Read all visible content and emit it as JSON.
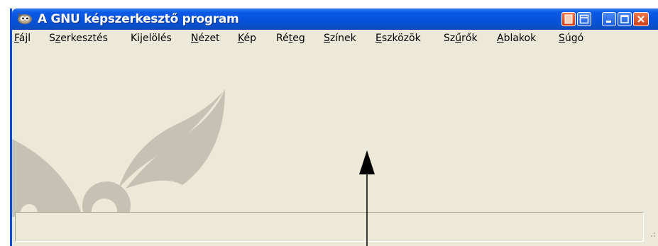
{
  "window": {
    "title": "A GNU képszerkesztő program"
  },
  "menu": [
    {
      "before": "",
      "key": "F",
      "after": "ájl"
    },
    {
      "before": "S",
      "key": "z",
      "after": "erkesztés"
    },
    {
      "before": "Ki",
      "key": "j",
      "after": "elölés"
    },
    {
      "before": "",
      "key": "N",
      "after": "ézet"
    },
    {
      "before": "",
      "key": "K",
      "after": "ép"
    },
    {
      "before": "Ré",
      "key": "t",
      "after": "eg"
    },
    {
      "before": "",
      "key": "S",
      "after": "zínek"
    },
    {
      "before": "",
      "key": "E",
      "after": "szközök"
    },
    {
      "before": "Sz",
      "key": "ű",
      "after": "rők"
    },
    {
      "before": "",
      "key": "A",
      "after": "blakok"
    },
    {
      "before": "",
      "key": "S",
      "after": "úgó"
    }
  ],
  "icons": {
    "app": "gimp-wilber-icon",
    "extra1": "orange-extra-button-icon",
    "extra2": "restore-extra-button-icon",
    "minimize": "minimize-icon",
    "maximize": "maximize-icon",
    "close": "close-icon",
    "pointer": "pointer-arrow-icon"
  },
  "colors": {
    "titlebar": "#0752da",
    "window_bg": "#ece9d8",
    "wilber_watermark": "#c5c2b4"
  }
}
